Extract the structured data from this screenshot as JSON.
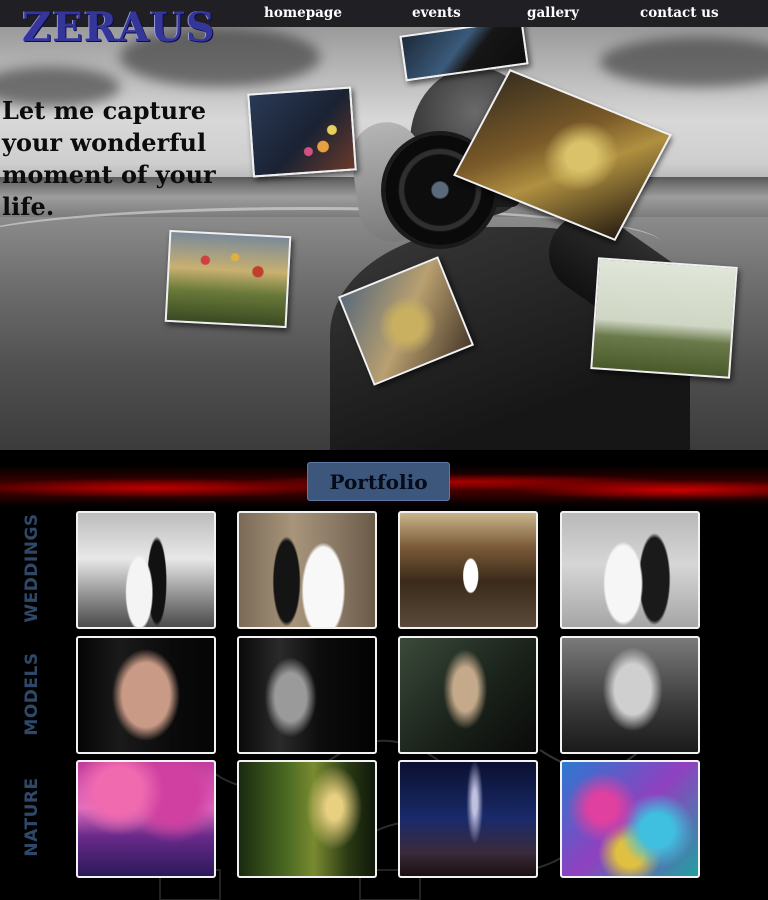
{
  "brand": {
    "logo": "ZERAUS"
  },
  "nav": {
    "links": [
      "homepage",
      "events",
      "gallery",
      "contact us"
    ]
  },
  "hero": {
    "tagline": "Let me capture your wonderful moment of your life."
  },
  "portfolio": {
    "title": "Portfolio",
    "categories": [
      {
        "label": "WEDDINGS",
        "photos": [
          "wedding-photo-1",
          "wedding-photo-2",
          "wedding-photo-3",
          "wedding-photo-4"
        ]
      },
      {
        "label": "MODELS",
        "photos": [
          "model-photo-1",
          "model-photo-2",
          "model-photo-3",
          "model-photo-4"
        ]
      },
      {
        "label": "NATURE",
        "photos": [
          "nature-photo-1",
          "nature-photo-2",
          "nature-photo-3",
          "nature-photo-4"
        ]
      }
    ]
  },
  "colors": {
    "nav_bg": "#1f1f24",
    "logo": "#35369a",
    "portfolio_button": "#3d577c",
    "category_label": "#2f4868",
    "accent_red": "#b00000"
  }
}
